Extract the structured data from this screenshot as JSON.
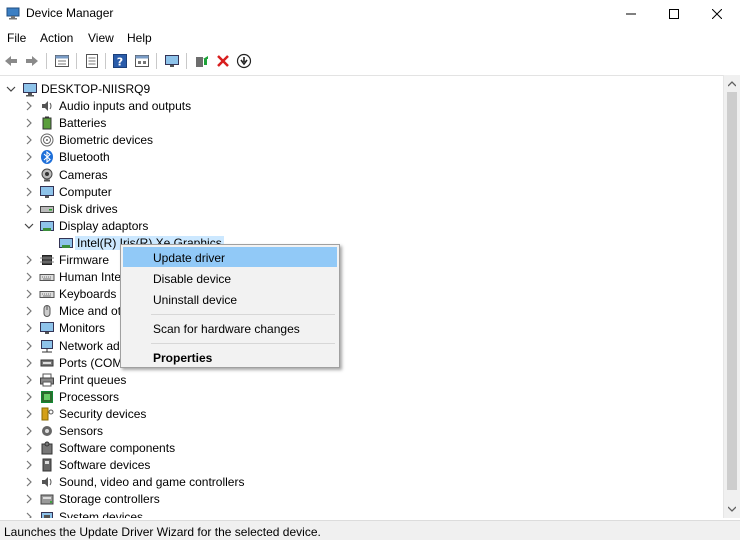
{
  "window": {
    "title": "Device Manager"
  },
  "menu": [
    "File",
    "Action",
    "View",
    "Help"
  ],
  "toolbar": [
    "back-arrow-icon",
    "forward-arrow-icon",
    "properties-view-icon",
    "list-view-icon",
    "help-icon",
    "resource-view-icon",
    "monitor-icon",
    "add-driver-icon",
    "uninstall-x-icon",
    "download-driver-icon"
  ],
  "tree": {
    "root": "DESKTOP-NIISRQ9",
    "items": [
      {
        "label": "Audio inputs and outputs",
        "icon": "speaker-icon"
      },
      {
        "label": "Batteries",
        "icon": "battery-icon"
      },
      {
        "label": "Biometric devices",
        "icon": "fingerprint-icon"
      },
      {
        "label": "Bluetooth",
        "icon": "bluetooth-icon"
      },
      {
        "label": "Cameras",
        "icon": "camera-icon"
      },
      {
        "label": "Computer",
        "icon": "computer-icon"
      },
      {
        "label": "Disk drives",
        "icon": "disk-icon"
      },
      {
        "label": "Display adaptors",
        "icon": "display-adapter-icon",
        "expanded": true
      },
      {
        "label": "Intel(R) Iris(R) Xe Graphics",
        "icon": "graphics-card-icon",
        "child": true,
        "selected": true
      },
      {
        "label": "Firmware",
        "icon": "chip-icon"
      },
      {
        "label": "Human Inte",
        "icon": "keyboard-icon"
      },
      {
        "label": "Keyboards",
        "icon": "keyboard-icon"
      },
      {
        "label": "Mice and ot",
        "icon": "mouse-icon"
      },
      {
        "label": "Monitors",
        "icon": "monitor-icon"
      },
      {
        "label": "Network ada",
        "icon": "network-icon"
      },
      {
        "label": "Ports (COM",
        "icon": "port-icon"
      },
      {
        "label": "Print queues",
        "icon": "printer-icon"
      },
      {
        "label": "Processors",
        "icon": "processor-icon"
      },
      {
        "label": "Security devices",
        "icon": "security-key-icon"
      },
      {
        "label": "Sensors",
        "icon": "sensor-icon"
      },
      {
        "label": "Software components",
        "icon": "puzzle-icon"
      },
      {
        "label": "Software devices",
        "icon": "software-device-icon"
      },
      {
        "label": "Sound, video and game controllers",
        "icon": "speaker-icon"
      },
      {
        "label": "Storage controllers",
        "icon": "storage-icon"
      },
      {
        "label": "System devices",
        "icon": "system-icon"
      }
    ]
  },
  "context_menu": {
    "items": [
      {
        "label": "Update driver",
        "highlighted": true
      },
      {
        "label": "Disable device"
      },
      {
        "label": "Uninstall device"
      },
      {
        "separator": true
      },
      {
        "label": "Scan for hardware changes"
      },
      {
        "separator": true
      },
      {
        "label": "Properties",
        "bold": true
      }
    ]
  },
  "status": {
    "text": "Launches the Update Driver Wizard for the selected device."
  },
  "colors": {
    "selection": "#cce8ff",
    "menu_highlight": "#91c9f7",
    "menu_bg": "#f2f2f2",
    "status_bg": "#f0f0f0"
  }
}
